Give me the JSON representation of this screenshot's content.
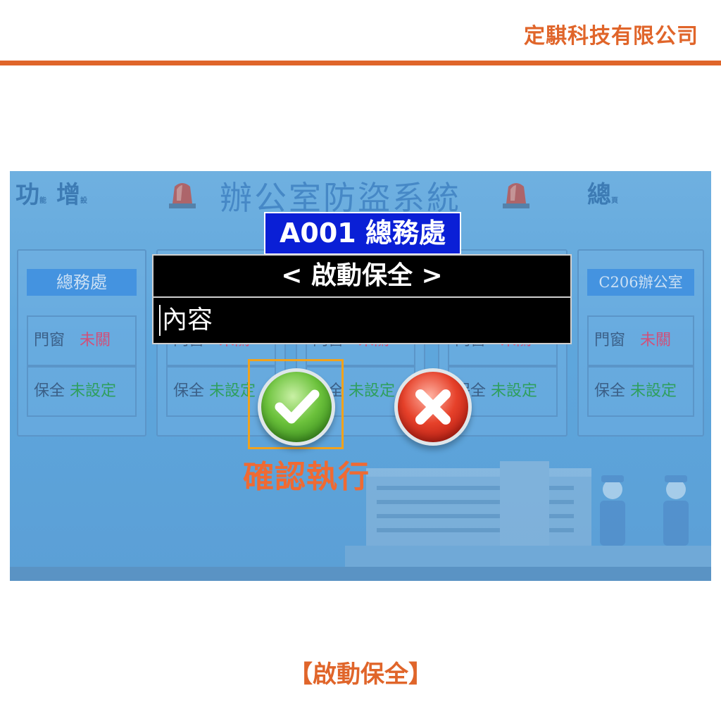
{
  "company": "定騏科技有限公司",
  "caption": "【啟動保全】",
  "screen": {
    "toolbar": {
      "func_label": "功",
      "func_sub": "能",
      "add_label": "增",
      "add_sub": "設",
      "total_label": "總",
      "total_sub": "頁"
    },
    "system_title": "辦公室防盜系統",
    "panels": [
      {
        "name": "總務處",
        "door_label": "門窗",
        "door_status": "未關",
        "guard_label": "保全",
        "guard_status": "未設定"
      },
      {
        "name": "",
        "door_label": "門窗",
        "door_status": "未關",
        "guard_label": "保全",
        "guard_status": "未設定"
      },
      {
        "name": "",
        "door_label": "門窗",
        "door_status": "未關",
        "guard_label": "保全",
        "guard_status": "未設定"
      },
      {
        "name": "",
        "door_label": "門窗",
        "door_status": "未關",
        "guard_label": "保全",
        "guard_status": "未設定"
      },
      {
        "name": "C206辦公室",
        "door_label": "門窗",
        "door_status": "未關",
        "guard_label": "保全",
        "guard_status": "未設定"
      }
    ],
    "room_header": "A001 總務處",
    "dialog": {
      "title": "< 啟動保全 >",
      "input_placeholder": "內容"
    },
    "confirm_label": "確認執行"
  },
  "colors": {
    "accent_orange": "#e0652a",
    "header_blue": "#0a1fd6",
    "confirm_highlight": "#f2a21c",
    "status_red": "#d0507a",
    "status_green": "#2f9f5e"
  },
  "icons": {
    "confirm": "check-circle-icon",
    "cancel": "x-circle-icon",
    "alarm": "siren-icon"
  }
}
